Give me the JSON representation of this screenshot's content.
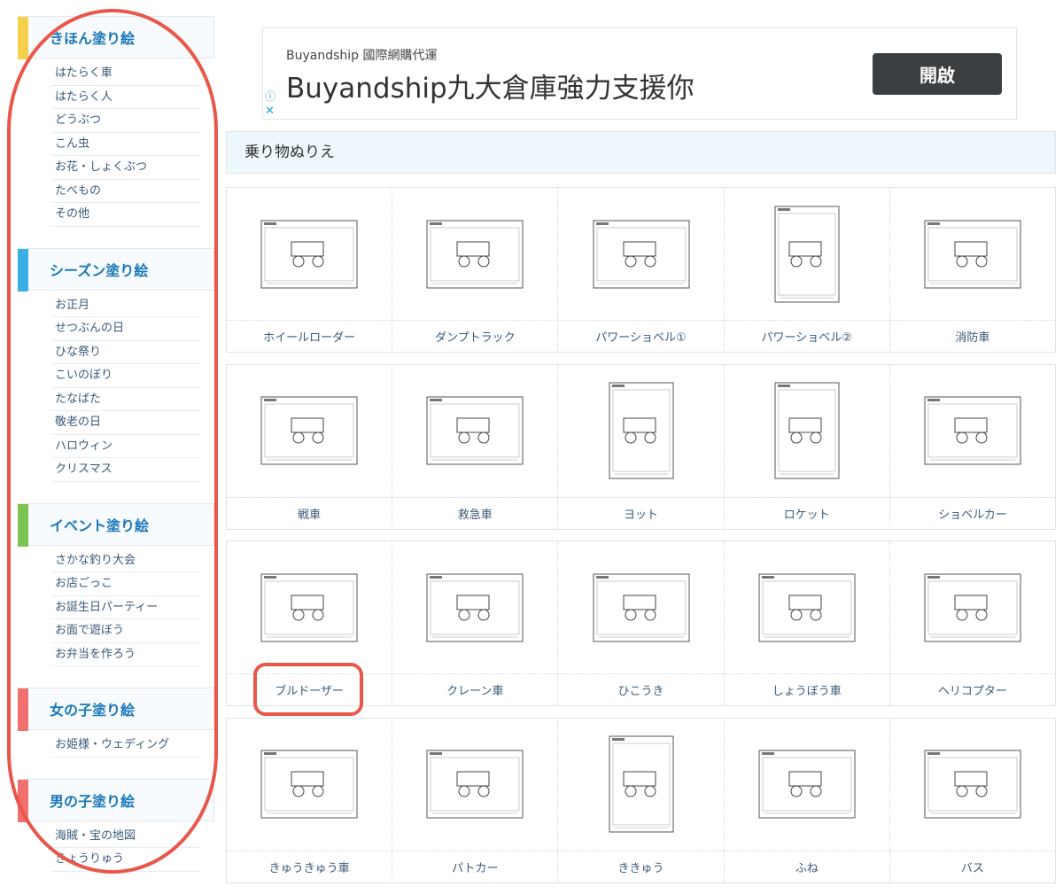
{
  "sidebar": {
    "sections": [
      {
        "title": "きほん塗り絵",
        "color": "#f5d04a",
        "items": [
          "はたらく車",
          "はたらく人",
          "どうぶつ",
          "こん虫",
          "お花・しょくぶつ",
          "たべもの",
          "その他"
        ]
      },
      {
        "title": "シーズン塗り絵",
        "color": "#3aaee6",
        "items": [
          "お正月",
          "せつぶんの日",
          "ひな祭り",
          "こいのぼり",
          "たなばた",
          "敬老の日",
          "ハロウィン",
          "クリスマス"
        ]
      },
      {
        "title": "イベント塗り絵",
        "color": "#7cc452",
        "items": [
          "さかな釣り大会",
          "お店ごっこ",
          "お誕生日パーティー",
          "お面で遊ぼう",
          "お弁当を作ろう"
        ]
      },
      {
        "title": "女の子塗り絵",
        "color": "#f07070",
        "items": [
          "お姫様・ウェディング"
        ]
      },
      {
        "title": "男の子塗り絵",
        "color": "#f07070",
        "items": [
          "海賊・宝の地図",
          "きょうりゅう"
        ]
      }
    ]
  },
  "ad": {
    "subtitle": "Buyandship 國際網購代運",
    "title": "Buyandship九大倉庫強力支援你",
    "button": "開啟",
    "info_icon": "ⓘ",
    "close_icon": "✕"
  },
  "category_title": "乗り物ぬりえ",
  "grid": [
    [
      {
        "label": "ホイールローダー",
        "orient": "l"
      },
      {
        "label": "ダンプトラック",
        "orient": "l"
      },
      {
        "label": "パワーショベル①",
        "orient": "l"
      },
      {
        "label": "パワーショベル②",
        "orient": "p"
      },
      {
        "label": "消防車",
        "orient": "l"
      }
    ],
    [
      {
        "label": "戦車",
        "orient": "l"
      },
      {
        "label": "救急車",
        "orient": "l"
      },
      {
        "label": "ヨット",
        "orient": "p"
      },
      {
        "label": "ロケット",
        "orient": "p"
      },
      {
        "label": "ショベルカー",
        "orient": "l"
      }
    ],
    [
      {
        "label": "ブルドーザー",
        "orient": "l"
      },
      {
        "label": "クレーン車",
        "orient": "l"
      },
      {
        "label": "ひこうき",
        "orient": "l"
      },
      {
        "label": "しょうぼう車",
        "orient": "l"
      },
      {
        "label": "ヘリコプター",
        "orient": "l"
      }
    ],
    [
      {
        "label": "きゅうきゅう車",
        "orient": "l"
      },
      {
        "label": "パトカー",
        "orient": "l"
      },
      {
        "label": "ききゅう",
        "orient": "p"
      },
      {
        "label": "ふね",
        "orient": "l"
      },
      {
        "label": "バス",
        "orient": "l"
      }
    ]
  ]
}
